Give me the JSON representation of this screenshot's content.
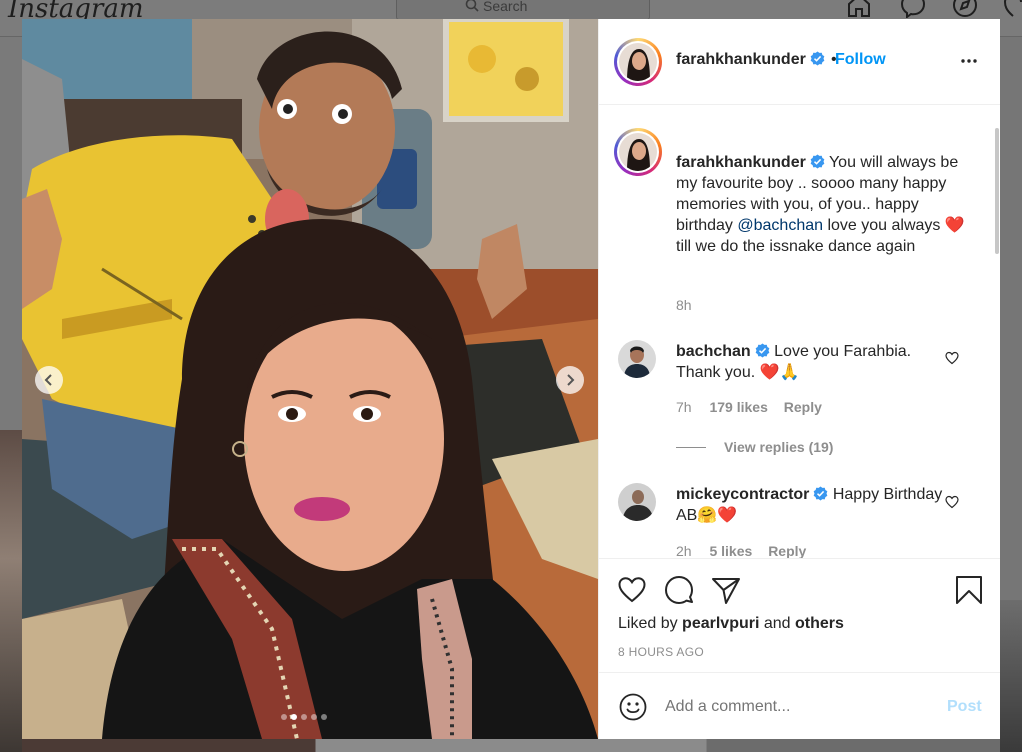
{
  "background": {
    "logo": "Instagram",
    "search_placeholder": "Search"
  },
  "post": {
    "author": "farahkhankunder",
    "follow_label": "Follow",
    "separator": "•",
    "caption_parts": {
      "before_mention": "You will always be my favourite boy .. soooo many happy memories with you, of you.. happy birthday ",
      "mention": "@bachchan",
      "after_mention": " love you always ",
      "heart": "❤️",
      "end": " till we do the issnake dance again"
    },
    "caption_time": "8h",
    "carousel": {
      "total": 5,
      "active_index": 1
    }
  },
  "comments": [
    {
      "username": "bachchan",
      "text": "Love you Farahbia. Thank you. ",
      "emoji": "❤️🙏",
      "time": "7h",
      "likes": "179 likes",
      "reply_label": "Reply",
      "view_replies": "View replies (19)"
    },
    {
      "username": "mickeycontractor",
      "text": "Happy Birthday AB",
      "emoji": "🤗❤️",
      "time": "2h",
      "likes": "5 likes",
      "reply_label": "Reply"
    }
  ],
  "actions": {
    "liked_by_prefix": "Liked by ",
    "liked_by_user": "pearlvpuri",
    "liked_by_and": " and ",
    "liked_by_others": "others",
    "timestamp": "8 HOURS AGO"
  },
  "add_comment": {
    "placeholder": "Add a comment...",
    "post_label": "Post"
  },
  "colors": {
    "link_blue": "#0095f6",
    "mention_blue": "#00376b",
    "verified_blue": "#3897f0",
    "muted": "#8e8e8e",
    "post_disabled": "#b2dffc"
  },
  "icons": [
    "search-icon",
    "home-icon",
    "messenger-icon",
    "explore-icon",
    "heart-icon",
    "comment-icon",
    "share-icon",
    "bookmark-icon",
    "emoji-icon",
    "more-icon",
    "verified-icon",
    "chevron-left-icon",
    "chevron-right-icon"
  ]
}
